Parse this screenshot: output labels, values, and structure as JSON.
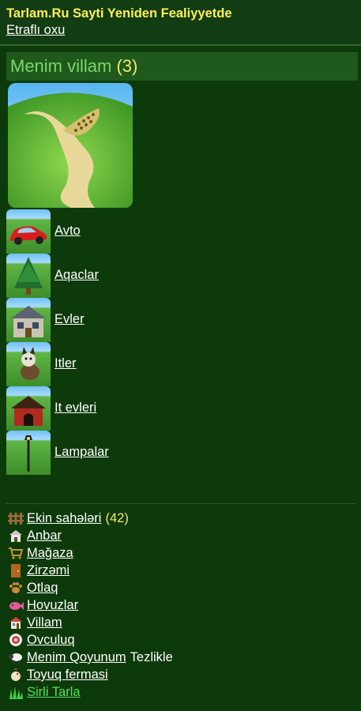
{
  "banner": {
    "title": "Tarlam.Ru Sayti Yeniden Fealiyyetde",
    "link": "Etraflı oxu"
  },
  "section": {
    "title": "Menim villam",
    "count": "(3)"
  },
  "categories": [
    {
      "label": "Avto",
      "icon": "car-icon"
    },
    {
      "label": "Aqaclar",
      "icon": "tree-icon"
    },
    {
      "label": "Evler",
      "icon": "house-icon"
    },
    {
      "label": "Itler",
      "icon": "dog-icon"
    },
    {
      "label": "It evleri",
      "icon": "doghouse-icon"
    },
    {
      "label": "Lampalar",
      "icon": "lamp-icon"
    }
  ],
  "menu": [
    {
      "label": "Ekin sahələri",
      "count": "(42)",
      "icon": "fence-icon"
    },
    {
      "label": "Anbar",
      "icon": "barn-icon"
    },
    {
      "label": "Mağaza",
      "icon": "cart-icon"
    },
    {
      "label": "Zirzəmi",
      "icon": "door-icon"
    },
    {
      "label": "Otlaq",
      "icon": "paw-icon"
    },
    {
      "label": "Hovuzlar",
      "icon": "fish-icon"
    },
    {
      "label": "Villam",
      "icon": "villa-icon"
    },
    {
      "label": "Ovculuq",
      "icon": "target-icon"
    },
    {
      "label": "Menim Qoyunum",
      "suffix": "Tezlikle",
      "icon": "sheep-icon"
    },
    {
      "label": "Toyuq fermasi",
      "icon": "chicken-icon"
    },
    {
      "label": "Sirli Tarla",
      "icon": "grass-icon"
    }
  ]
}
